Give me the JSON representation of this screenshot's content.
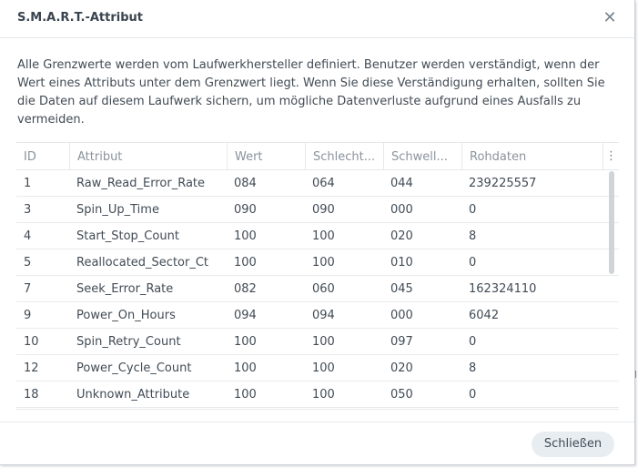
{
  "dialog": {
    "title": "S.M.A.R.T.-Attribut",
    "close_icon": "close-icon",
    "description": "Alle Grenzwerte werden vom Laufwerkhersteller definiert. Benutzer werden verständigt, wenn der Wert eines Attributs unter dem Grenzwert liegt. Wenn Sie diese Verständigung erhalten, sollten Sie die Daten auf diesem Laufwerk sichern, um mögliche Datenverluste aufgrund eines Ausfalls zu vermeiden."
  },
  "table": {
    "columns": [
      "ID",
      "Attribut",
      "Wert",
      "Schlecht...",
      "Schwell...",
      "Rohdaten"
    ],
    "column_menu_icon": "vertical-dots-icon",
    "rows": [
      [
        "1",
        "Raw_Read_Error_Rate",
        "084",
        "064",
        "044",
        "239225557"
      ],
      [
        "3",
        "Spin_Up_Time",
        "090",
        "090",
        "000",
        "0"
      ],
      [
        "4",
        "Start_Stop_Count",
        "100",
        "100",
        "020",
        "8"
      ],
      [
        "5",
        "Reallocated_Sector_Ct",
        "100",
        "100",
        "010",
        "0"
      ],
      [
        "7",
        "Seek_Error_Rate",
        "082",
        "060",
        "045",
        "162324110"
      ],
      [
        "9",
        "Power_On_Hours",
        "094",
        "094",
        "000",
        "6042"
      ],
      [
        "10",
        "Spin_Retry_Count",
        "100",
        "100",
        "097",
        "0"
      ],
      [
        "12",
        "Power_Cycle_Count",
        "100",
        "100",
        "020",
        "8"
      ],
      [
        "18",
        "Unknown_Attribute",
        "100",
        "100",
        "050",
        "0"
      ]
    ]
  },
  "footer": {
    "close_button": "Schließen"
  },
  "colors": {
    "text": "#414b55",
    "header_text": "#8a939c",
    "border": "#e5e8eb",
    "button_bg": "#e8edf2"
  }
}
